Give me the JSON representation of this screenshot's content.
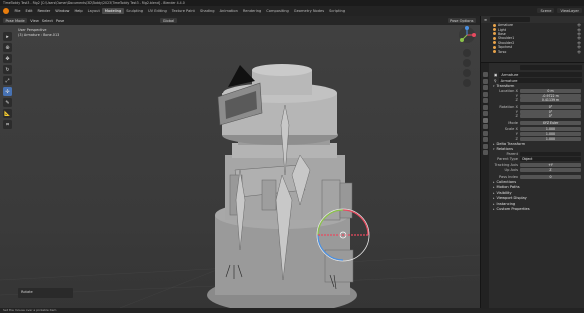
{
  "window": {
    "title": "TimeToddy Test3 - Rig2 [C:\\Users\\Owner\\Documents\\3D\\Toddy\\2023\\TimeToddy Test3 - Rig2.blend] - Blender 4.4.0"
  },
  "menu": {
    "items": [
      "File",
      "Edit",
      "Render",
      "Window",
      "Help"
    ],
    "workspaces": [
      "Layout",
      "Modeling",
      "Sculpting",
      "UV Editing",
      "Texture Paint",
      "Shading",
      "Animation",
      "Rendering",
      "Compositing",
      "Geometry Nodes",
      "Scripting"
    ],
    "active_workspace": "Modeling",
    "scene_label": "Scene",
    "view_layer_label": "ViewLayer"
  },
  "viewport_header": {
    "mode": "Pose Mode",
    "view": "View",
    "select": "Select",
    "pose": "Pose",
    "orientation": "Global",
    "options": "Pose Options"
  },
  "toolbar_settings": {
    "orientation_label": "Orientation:",
    "orientation_value": "Default",
    "drag_label": "Drag:",
    "drag_value": "Select Box"
  },
  "viewport_info": {
    "line1": "User Perspective",
    "line2": "(3) Armature : Bone.013"
  },
  "operator_panel": {
    "label": "Rotate"
  },
  "status": {
    "text": "Set the mouse over a pickable item"
  },
  "outliner": {
    "items": [
      {
        "label": "Armature"
      },
      {
        "label": "Light"
      },
      {
        "label": "Base"
      },
      {
        "label": "Shoulder1"
      },
      {
        "label": "Shoulder2"
      },
      {
        "label": "Topchest"
      },
      {
        "label": "Torso"
      }
    ]
  },
  "properties": {
    "object_name": "Armature",
    "data_name": "Armature",
    "sections": {
      "transform": "Transform",
      "delta": "Delta Transform",
      "relations": "Relations",
      "collections": "Collections",
      "motion_paths": "Motion Paths",
      "visibility": "Visibility",
      "viewport_display": "Viewport Display",
      "instancing": "Instancing",
      "custom_properties": "Custom Properties"
    },
    "location": {
      "label": "Location X",
      "x": "0 m",
      "y": "-0.9722 m",
      "z": "0.41139 m",
      "y_label": "Y",
      "z_label": "Z"
    },
    "rotation": {
      "label": "Rotation X",
      "x": "0°",
      "y": "0°",
      "z": "0°",
      "y_label": "Y",
      "z_label": "Z"
    },
    "mode": {
      "label": "Mode",
      "value": "XYZ Euler"
    },
    "scale": {
      "label": "Scale X",
      "x": "1.000",
      "y": "1.000",
      "z": "1.000",
      "y_label": "Y",
      "z_label": "Z"
    },
    "relations": {
      "parent_label": "Parent",
      "parent_type_label": "Parent Type",
      "parent_type_value": "Object",
      "tracking_label": "Tracking Axis",
      "tracking_value": "+Y",
      "up_label": "Up Axis",
      "up_value": "Z",
      "pass_label": "Pass Index",
      "pass_value": "0"
    }
  },
  "colors": {
    "accent": "#4772b3",
    "orange": "#e87d0d",
    "x_axis": "#e84a5f",
    "y_axis": "#8bc34a",
    "z_axis": "#4a90e2"
  }
}
